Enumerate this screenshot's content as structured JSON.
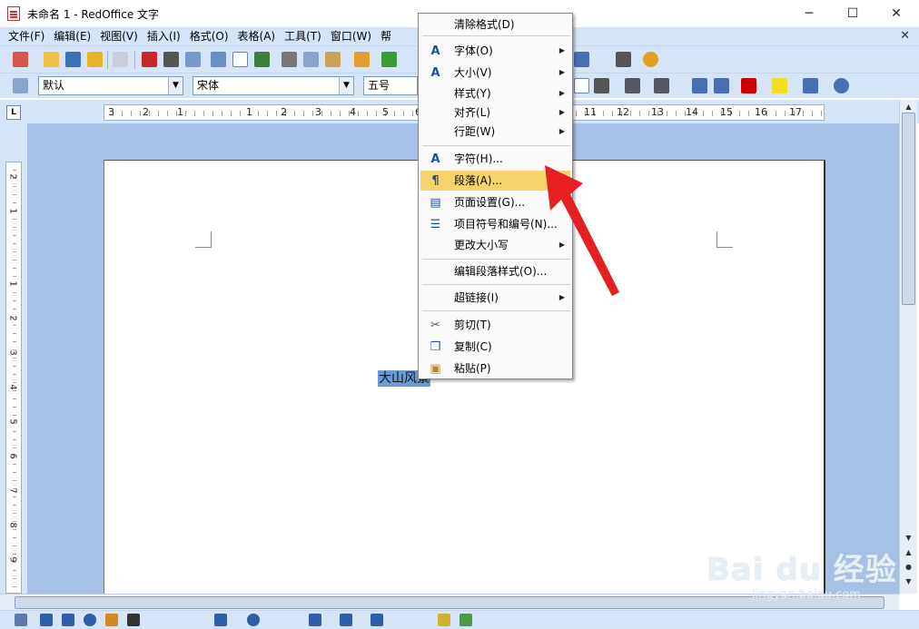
{
  "window": {
    "title": "未命名 1 - RedOffice 文字",
    "minimize": "─",
    "maximize": "☐",
    "close": "✕"
  },
  "menubar": {
    "items": [
      "文件(F)",
      "编辑(E)",
      "视图(V)",
      "插入(I)",
      "格式(O)",
      "表格(A)",
      "工具(T)",
      "窗口(W)",
      "帮"
    ],
    "doc_close": "✕"
  },
  "formatting": {
    "style_value": "默认",
    "font_value": "宋体",
    "size_value": "五号"
  },
  "ruler": {
    "h_labels": [
      "3",
      "2",
      "1",
      "1",
      "2",
      "3",
      "4",
      "5",
      "6",
      "11",
      "12",
      "13",
      "14",
      "15",
      "16",
      "17"
    ],
    "v_labels": [
      "2",
      "1",
      "1",
      "2",
      "3",
      "4",
      "5",
      "6",
      "7",
      "8",
      "9"
    ],
    "corner_button": "L"
  },
  "document": {
    "selected_text": "大山风景"
  },
  "context_menu": {
    "items": [
      {
        "label": "清除格式(D)",
        "icon": "",
        "submenu": false
      },
      {
        "label": "字体(O)",
        "icon": "font-icon",
        "submenu": true
      },
      {
        "label": "大小(V)",
        "icon": "font-size-icon",
        "submenu": true
      },
      {
        "label": "样式(Y)",
        "icon": "",
        "submenu": true
      },
      {
        "label": "对齐(L)",
        "icon": "",
        "submenu": true
      },
      {
        "label": "行距(W)",
        "icon": "",
        "submenu": true
      },
      {
        "label": "字符(H)...",
        "icon": "character-icon",
        "submenu": false
      },
      {
        "label": "段落(A)...",
        "icon": "paragraph-icon",
        "submenu": false,
        "highlighted": true
      },
      {
        "label": "页面设置(G)...",
        "icon": "page-setup-icon",
        "submenu": false
      },
      {
        "label": "项目符号和编号(N)...",
        "icon": "bullets-icon",
        "submenu": false
      },
      {
        "label": "更改大小写",
        "icon": "",
        "submenu": true
      },
      {
        "label": "编辑段落样式(O)...",
        "icon": "",
        "submenu": false
      },
      {
        "label": "超链接(I)",
        "icon": "",
        "submenu": true
      },
      {
        "label": "剪切(T)",
        "icon": "cut-icon",
        "submenu": false
      },
      {
        "label": "复制(C)",
        "icon": "copy-icon",
        "submenu": false
      },
      {
        "label": "粘贴(P)",
        "icon": "paste-icon",
        "submenu": false
      }
    ],
    "submenu_arrow": "▶"
  },
  "watermark": {
    "logo": "Bai du 经验",
    "url": "jingyan.baidu.com"
  },
  "colors": {
    "chrome": "#d6e4f7",
    "doc_bg": "#a6c0e6",
    "highlight": "#f7d36d",
    "selection": "#6b9ad6",
    "arrow": "#e62020"
  }
}
